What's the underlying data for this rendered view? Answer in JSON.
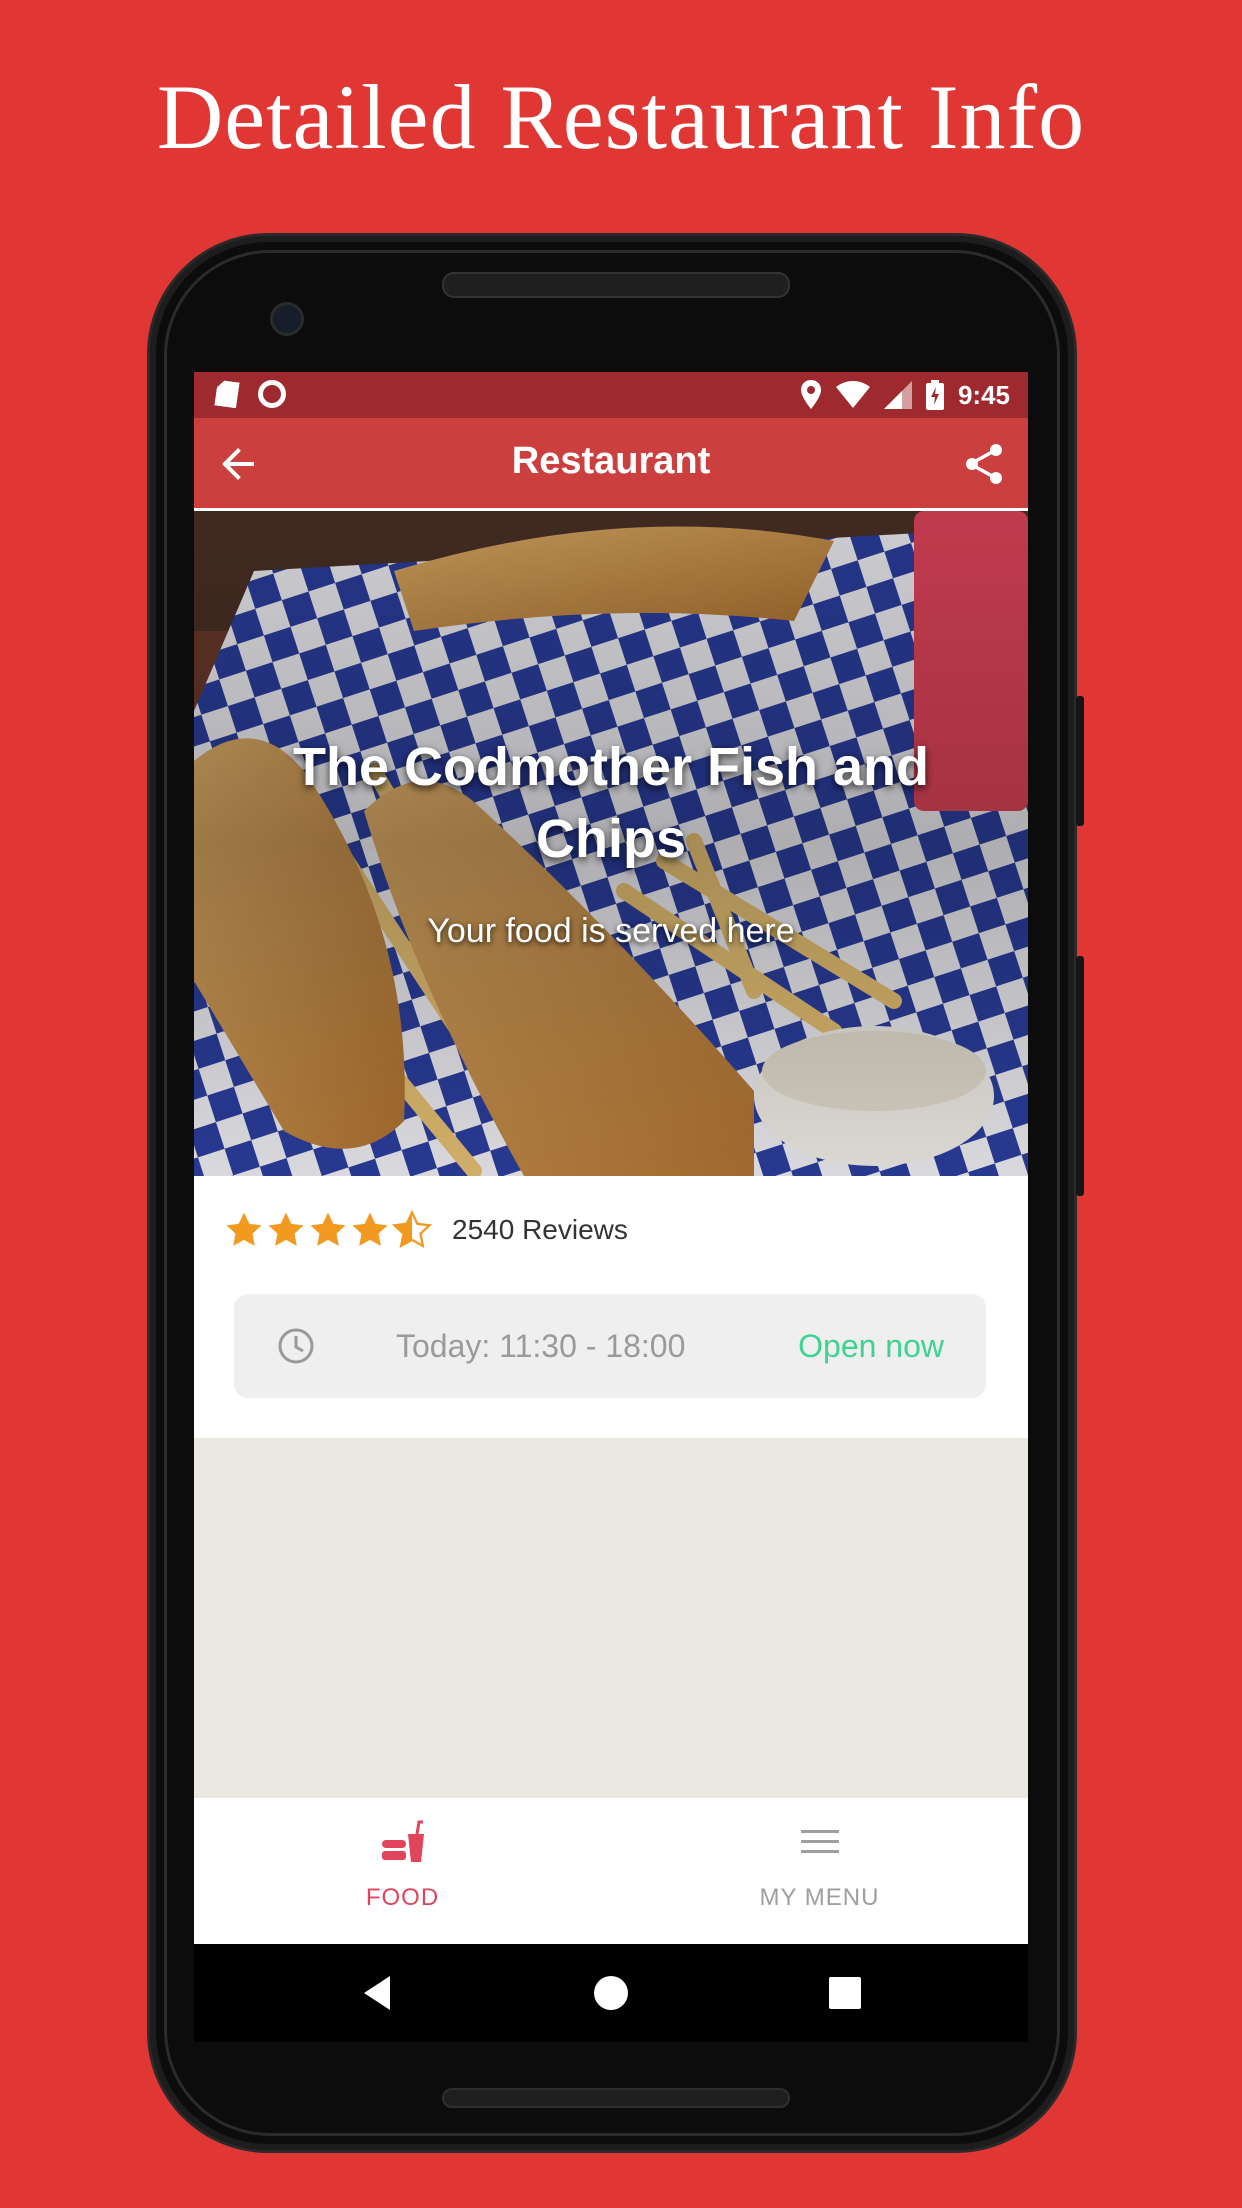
{
  "promo": {
    "title": "Detailed Restaurant Info"
  },
  "status_bar": {
    "time": "9:45"
  },
  "app_bar": {
    "title": "Restaurant"
  },
  "hero": {
    "title": "The Codmother Fish and Chips",
    "subtitle": "Your food is served here"
  },
  "rating": {
    "stars": 4.5,
    "max": 5,
    "reviews_label": "2540 Reviews"
  },
  "hours": {
    "text": "Today: 11:30 - 18:00",
    "status": "Open now"
  },
  "bottom_nav": {
    "items": [
      {
        "label": "FOOD",
        "icon": "fastfood-icon",
        "active": true
      },
      {
        "label": "MY MENU",
        "icon": "menu-lines-icon",
        "active": false
      }
    ]
  },
  "colors": {
    "background": "#e03634",
    "app_bar": "#cc3f3f",
    "status_bar": "#9e2a30",
    "accent": "#e0455c",
    "open": "#3fd392",
    "star": "#f29a1f"
  }
}
